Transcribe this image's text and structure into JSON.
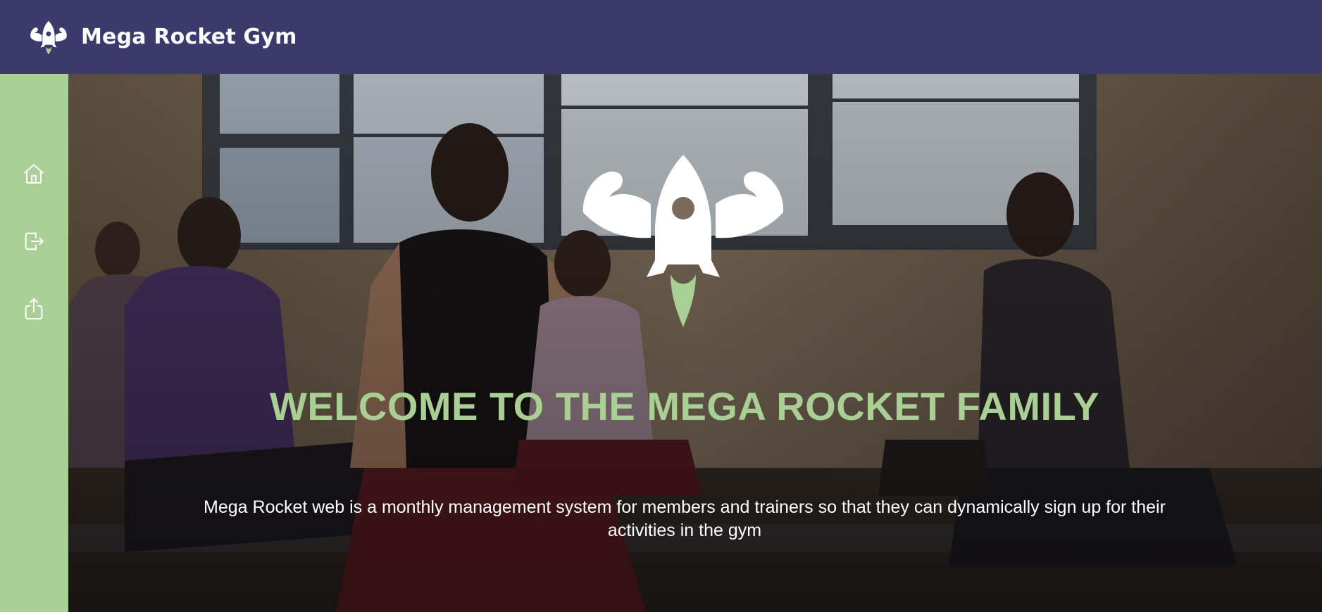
{
  "header": {
    "brand_name": "Mega Rocket Gym",
    "logo_icon": "rocket-flexing-arms-icon",
    "background_color": "#3b3a6d"
  },
  "sidebar": {
    "background_color": "#a9cf94",
    "items": [
      {
        "name": "home",
        "icon": "home-icon"
      },
      {
        "name": "logout",
        "icon": "logout-icon"
      },
      {
        "name": "share",
        "icon": "share-icon"
      }
    ]
  },
  "hero": {
    "background_image": "yoga-class-photo",
    "logo_icon": "rocket-flexing-arms-icon",
    "title": "WELCOME TO THE MEGA ROCKET FAMILY",
    "title_color": "#a9cf94",
    "description": "Mega Rocket web is a monthly management system for members and trainers so that they can dynamically sign up for their activities in the gym"
  }
}
